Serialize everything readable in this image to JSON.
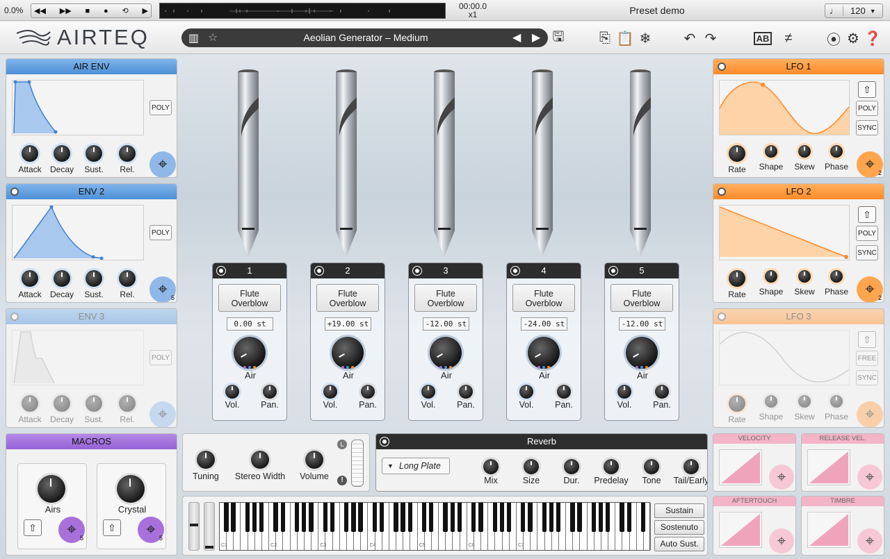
{
  "transport": {
    "cpu": "0.0%",
    "time": "00:00.0",
    "speed": "x1",
    "preset_label": "Preset demo",
    "tempo": "120"
  },
  "header": {
    "logo": "AIRTEQ",
    "preset_name": "Aeolian Generator – Medium"
  },
  "air_env": {
    "title": "AIR ENV",
    "poly": "POLY",
    "knobs": [
      "Attack",
      "Decay",
      "Sust.",
      "Rel."
    ]
  },
  "env2": {
    "title": "ENV 2",
    "poly": "POLY",
    "knobs": [
      "Attack",
      "Decay",
      "Sust.",
      "Rel."
    ],
    "targets": "5"
  },
  "env3": {
    "title": "ENV 3",
    "poly": "POLY",
    "knobs": [
      "Attack",
      "Decay",
      "Sust.",
      "Rel."
    ]
  },
  "lfo1": {
    "title": "LFO 1",
    "poly": "POLY",
    "sync": "SYNC",
    "knobs": [
      "Rate",
      "Shape",
      "Skew",
      "Phase"
    ],
    "targets": "2"
  },
  "lfo2": {
    "title": "LFO 2",
    "poly": "POLY",
    "sync": "SYNC",
    "knobs": [
      "Rate",
      "Shape",
      "Skew",
      "Phase"
    ],
    "targets": "2"
  },
  "lfo3": {
    "title": "LFO 3",
    "free": "FREE",
    "sync": "SYNC",
    "knobs": [
      "Rate",
      "Shape",
      "Skew",
      "Phase"
    ]
  },
  "macros": {
    "title": "MACROS",
    "items": [
      {
        "label": "Airs",
        "targets": "5"
      },
      {
        "label": "Crystal",
        "targets": "5"
      }
    ]
  },
  "strips": [
    {
      "num": "1",
      "instrument": "Flute Overblow",
      "semitones": "0.00 st",
      "air": "Air",
      "vol": "Vol.",
      "pan": "Pan."
    },
    {
      "num": "2",
      "instrument": "Flute Overblow",
      "semitones": "+19.00 st",
      "air": "Air",
      "vol": "Vol.",
      "pan": "Pan."
    },
    {
      "num": "3",
      "instrument": "Flute Overblow",
      "semitones": "-12.00 st",
      "air": "Air",
      "vol": "Vol.",
      "pan": "Pan."
    },
    {
      "num": "4",
      "instrument": "Flute Overblow",
      "semitones": "-24.00 st",
      "air": "Air",
      "vol": "Vol.",
      "pan": "Pan."
    },
    {
      "num": "5",
      "instrument": "Flute Overblow",
      "semitones": "-12.00 st",
      "air": "Air",
      "vol": "Vol.",
      "pan": "Pan."
    }
  ],
  "global": {
    "knobs": [
      "Tuning",
      "Stereo Width",
      "Volume"
    ],
    "meter_l": "L",
    "meter_warn": "!"
  },
  "reverb": {
    "title": "Reverb",
    "type": "Long Plate",
    "knobs": [
      "Mix",
      "Size",
      "Dur.",
      "Predelay",
      "Tone",
      "Tail/Early"
    ]
  },
  "keyboard": {
    "octaves": [
      "C1",
      "C2",
      "C3",
      "C4",
      "C5",
      "C6",
      "C7"
    ],
    "pedals": [
      "Sustain",
      "Sostenuto",
      "Auto Sust."
    ]
  },
  "mods": [
    "VELOCITY",
    "RELEASE VEL.",
    "AFTERTOUCH",
    "TIMBRE"
  ],
  "colors": {
    "env": "#4d8fd6",
    "lfo": "#ff8a28",
    "macro": "#9562d6",
    "mod": "#f4b4c8"
  }
}
